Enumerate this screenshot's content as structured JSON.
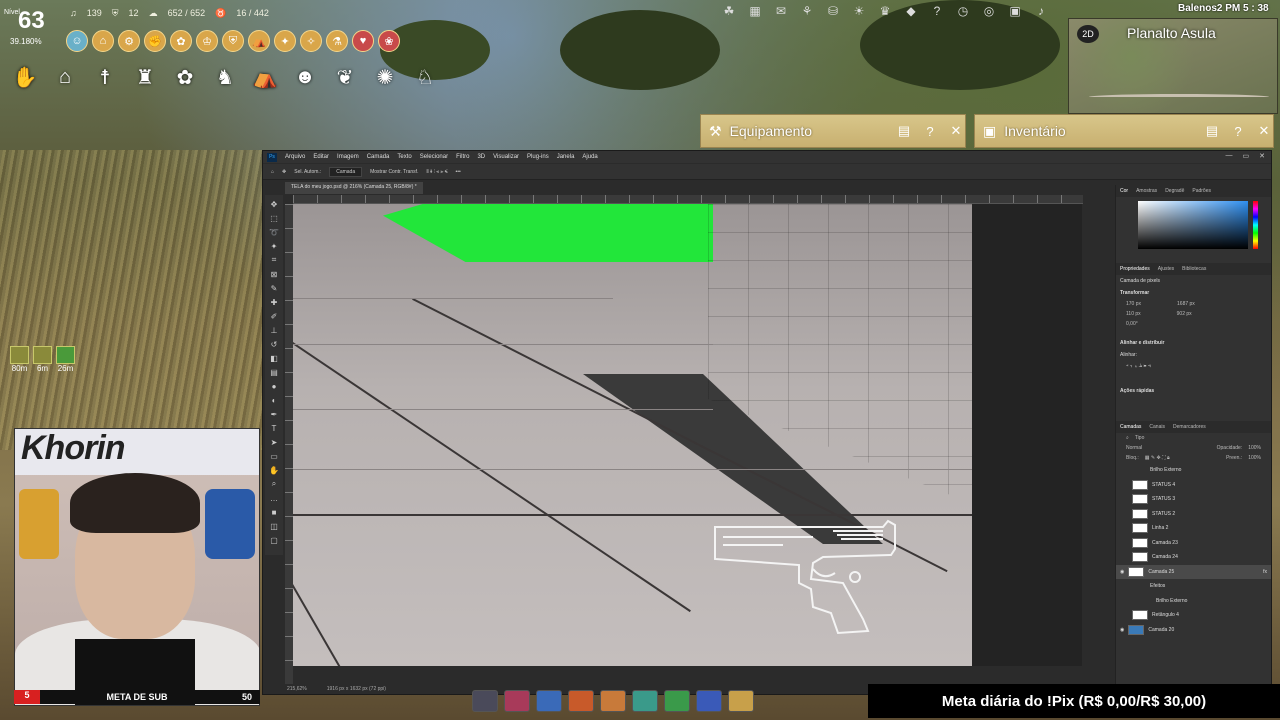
{
  "hud": {
    "level_label": "Nível",
    "level": "63",
    "level_percent": "39.180%",
    "stat_music": "139",
    "stat_shield": "12",
    "energy": "652 / 652",
    "weight": "16 / 442",
    "buffs": [
      "80m",
      "6m",
      "26m"
    ],
    "username": "Balenos2",
    "clock": "PM 5 : 38"
  },
  "minimap": {
    "mode": "2D",
    "region": "Planalto Asula"
  },
  "game_windows": {
    "equipment": {
      "title": "Equipamento"
    },
    "inventory": {
      "title": "Inventário"
    }
  },
  "photoshop": {
    "menu": [
      "Arquivo",
      "Editar",
      "Imagem",
      "Camada",
      "Texto",
      "Selecionar",
      "Filtro",
      "3D",
      "Visualizar",
      "Plug-ins",
      "Janela",
      "Ajuda"
    ],
    "options": {
      "auto_select": "Sel. Autom.:",
      "auto_select_value": "Camada",
      "show_transform": "Mostrar Contr. Transf."
    },
    "document_tab": "TELA do meu jogo.psd @ 216% (Camada 25, RGB/8#) *",
    "status_zoom": "215,62%",
    "status_size": "1916 px x 1632 px (72 ppi)",
    "color_tabs": [
      "Cor",
      "Amostras",
      "Degradê",
      "Padrões"
    ],
    "props_tabs": [
      "Propriedades",
      "Ajustes",
      "Bibliotecas"
    ],
    "props": {
      "layer_type": "Camada de pixels",
      "transform_label": "Transformar",
      "w": "170 px",
      "h": "110 px",
      "x": "1687 px",
      "y": "902 px",
      "angle": "0,00°",
      "align_label": "Alinhar e distribuir",
      "align_sub": "Alinhar:",
      "quick_actions": "Ações rápidas"
    },
    "layers_tabs": [
      "Camadas",
      "Canais",
      "Demarcadores"
    ],
    "layers_filter": "Tipo",
    "blend_mode": "Normal",
    "opacity_label": "Opacidade:",
    "opacity": "100%",
    "lock_label": "Bloq.:",
    "fill_label": "Preen.:",
    "fill": "100%",
    "layers": [
      "Brilho Externo",
      "STATUS 4",
      "STATUS 3",
      "STATUS 2",
      "Linha 2",
      "Camada 23",
      "Camada 24",
      "Camada 25",
      "Efeitos",
      "Brilho Externo",
      "Retângulo 4",
      "Camada 20"
    ]
  },
  "stream": {
    "sub_goal_left": "5",
    "sub_goal_label": "META DE SUB",
    "sub_goal_right": "50",
    "pix_goal": "Meta diária do !Pix (R$ 0,00/R$ 30,00)",
    "banner_text": "Khorin"
  },
  "colors": {
    "accent_green": "#22e63a",
    "ps_bg": "#2b2b2b",
    "window_gold": "#d8c68a"
  }
}
